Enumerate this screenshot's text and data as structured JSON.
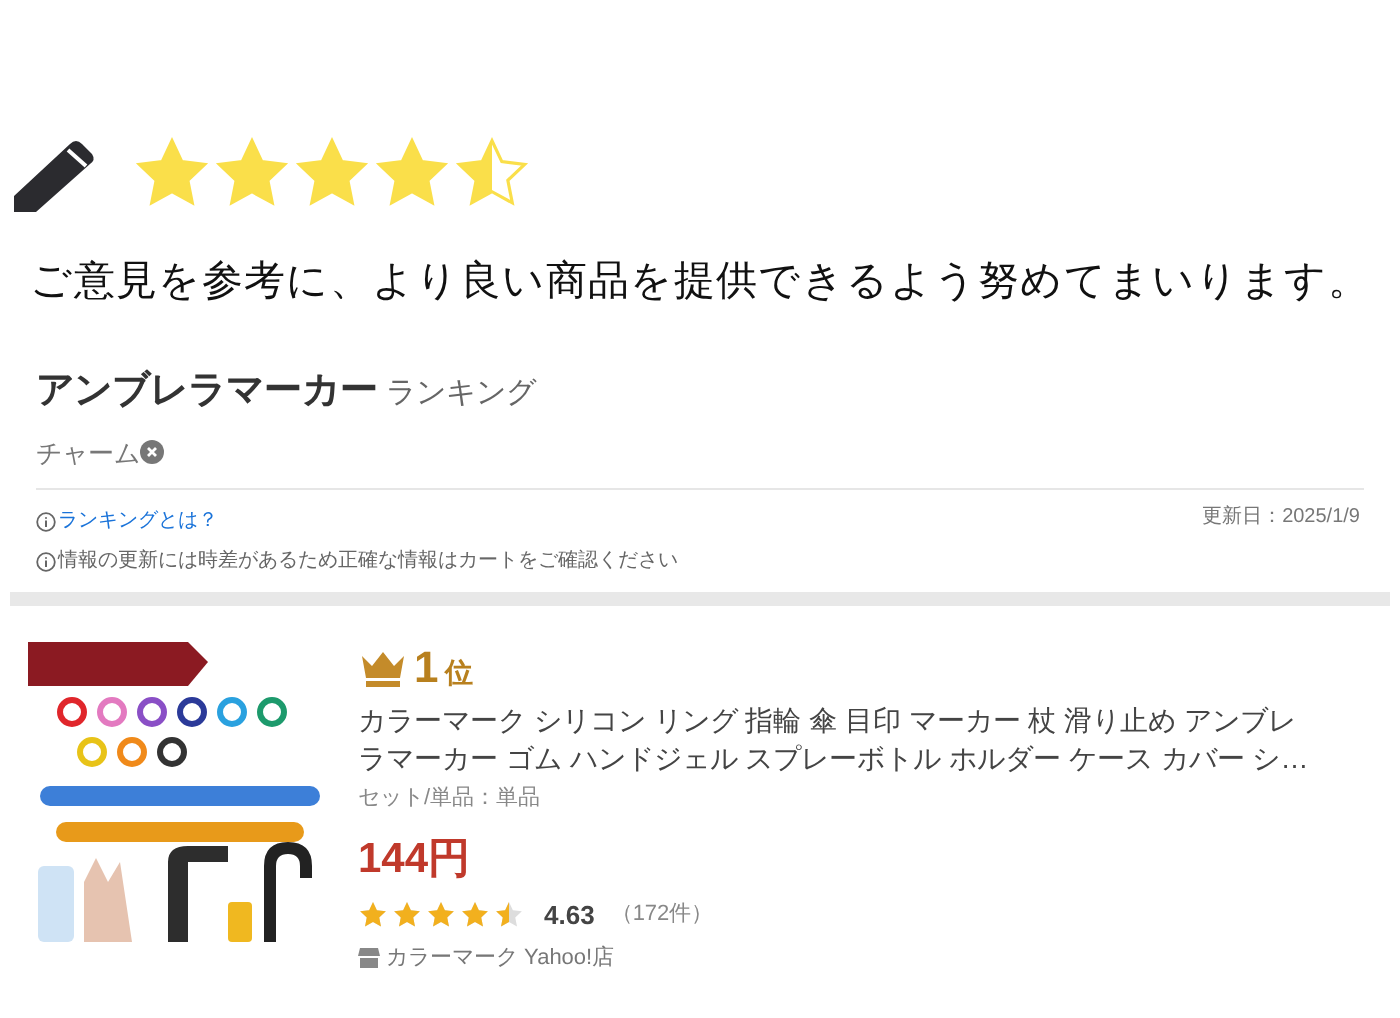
{
  "review": {
    "stars": 4.5,
    "message": "ご意見を参考に、より良い商品を提供できるよう努めてまいります。"
  },
  "ranking": {
    "title": "アンブレラマーカー",
    "suffix": "ランキング",
    "filter_tag": "チャーム",
    "help_link": "ランキングとは？",
    "updated": "更新日：2025/1/9",
    "notice": "情報の更新には時差があるため正確な情報はカートをご確認ください"
  },
  "items": [
    {
      "rank_number": "1",
      "rank_unit": "位",
      "title_lines": [
        "カラーマーク シリコン リング 指輪 傘 目印 マーカー 杖 滑り止め アンブレ",
        "ラマーカー ゴム ハンドジェル スプレーボトル ホルダー ケース カバー シ…"
      ],
      "variant": "セット/単品：単品",
      "price": "144円",
      "stars": 4.5,
      "rating": "4.63",
      "review_count": "（172件）",
      "shop": "カラーマーク Yahoo!店"
    }
  ]
}
